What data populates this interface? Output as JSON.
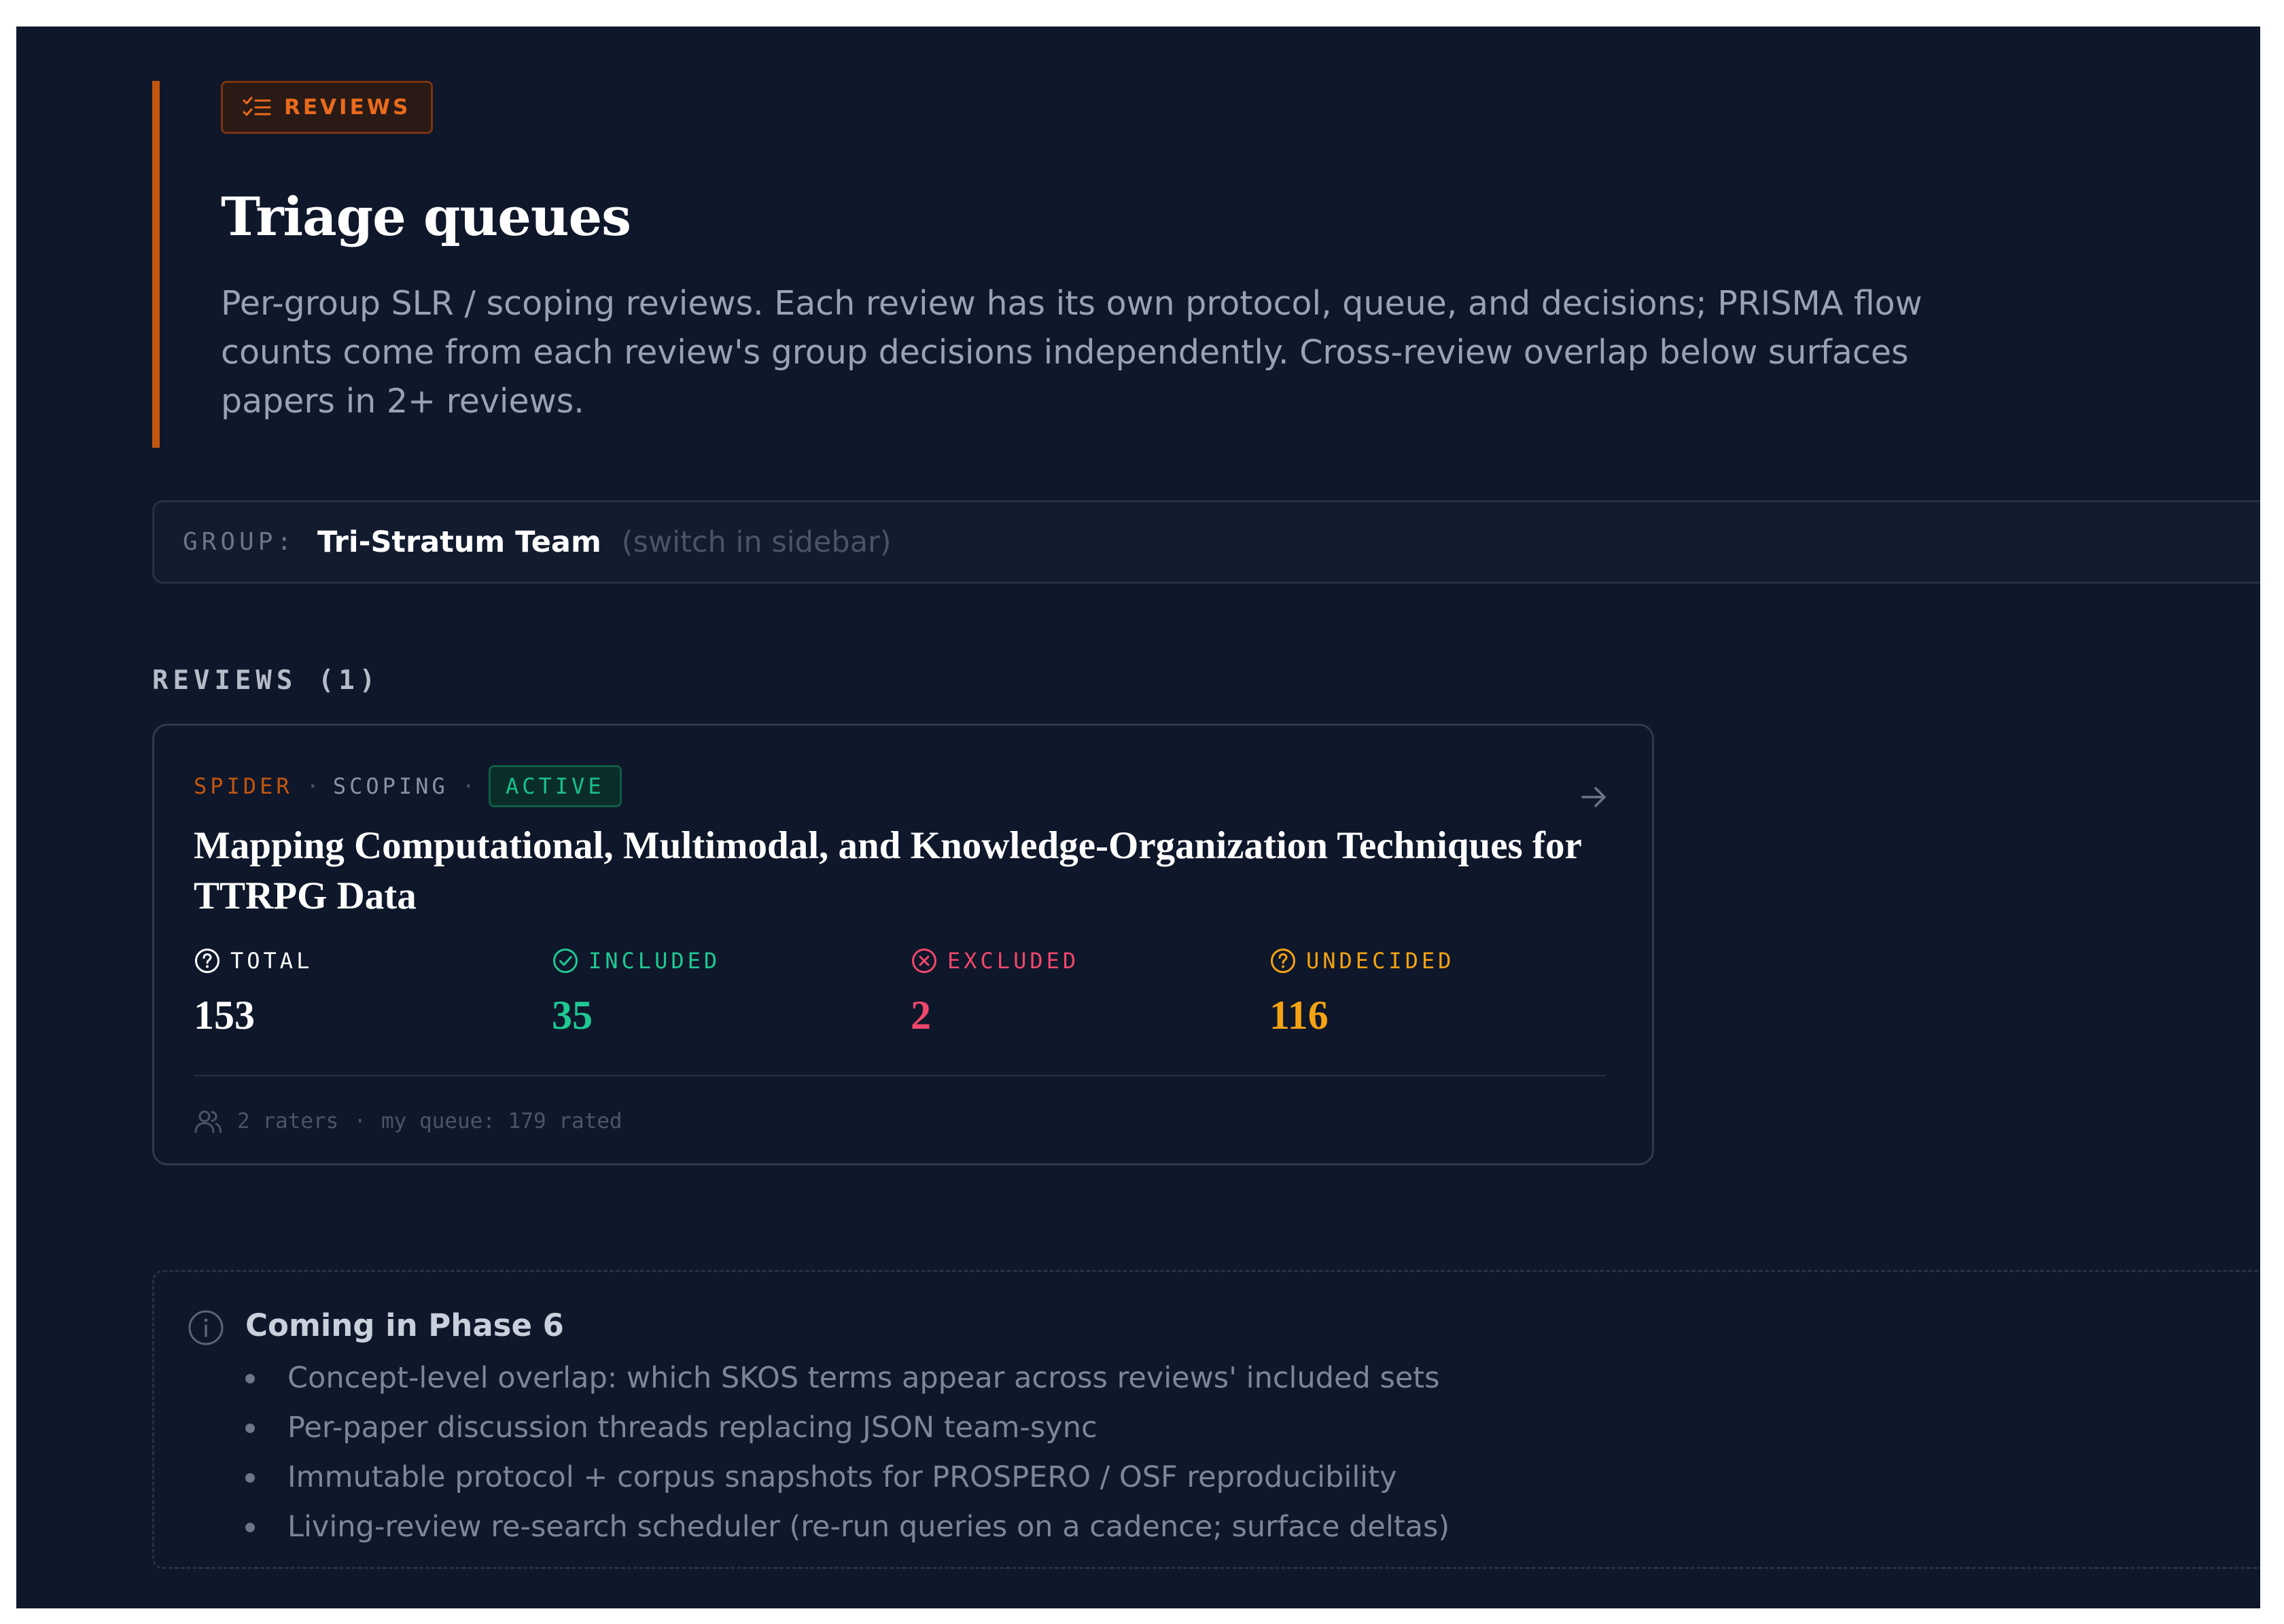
{
  "header": {
    "tag_icon": "list-check-icon",
    "tag_label": "REVIEWS",
    "title": "Triage queues",
    "description": "Per-group SLR / scoping reviews. Each review has its own protocol, queue, and decisions; PRISMA flow counts come from each review's group decisions independently. Cross-review overlap below surfaces papers in 2+ reviews.",
    "accent_color": "#c2560f"
  },
  "group": {
    "label": "GROUP:",
    "name": "Tri-Stratum Team",
    "hint": "(switch in sidebar)"
  },
  "reviews": {
    "heading": "REVIEWS (1)",
    "items": [
      {
        "framework": "SPIDER",
        "separator": "·",
        "type": "SCOPING",
        "status": "ACTIVE",
        "open_icon": "arrow-right-icon",
        "title": "Mapping Computational, Multimodal, and Knowledge-Organization Techniques for TTRPG Data",
        "stats": [
          {
            "icon": "question-circle-icon",
            "label": "TOTAL",
            "value": "153",
            "color": "#ffffff"
          },
          {
            "icon": "check-circle-icon",
            "label": "INCLUDED",
            "value": "35",
            "color": "#1fc993"
          },
          {
            "icon": "x-circle-icon",
            "label": "EXCLUDED",
            "value": "2",
            "color": "#f0476b"
          },
          {
            "icon": "question-circle-icon",
            "label": "UNDECIDED",
            "value": "116",
            "color": "#f5a312"
          }
        ],
        "footer": {
          "icon": "users-icon",
          "raters": "2 raters",
          "separator": "·",
          "queue": "my queue: 179 rated"
        }
      }
    ]
  },
  "phase_note": {
    "icon": "info-icon",
    "title": "Coming in Phase 6",
    "items": [
      "Concept-level overlap: which SKOS terms appear across reviews' included sets",
      "Per-paper discussion threads replacing JSON team-sync",
      "Immutable protocol + corpus snapshots for PROSPERO / OSF reproducibility",
      "Living-review re-search scheduler (re-run queries on a cadence; surface deltas)"
    ]
  }
}
